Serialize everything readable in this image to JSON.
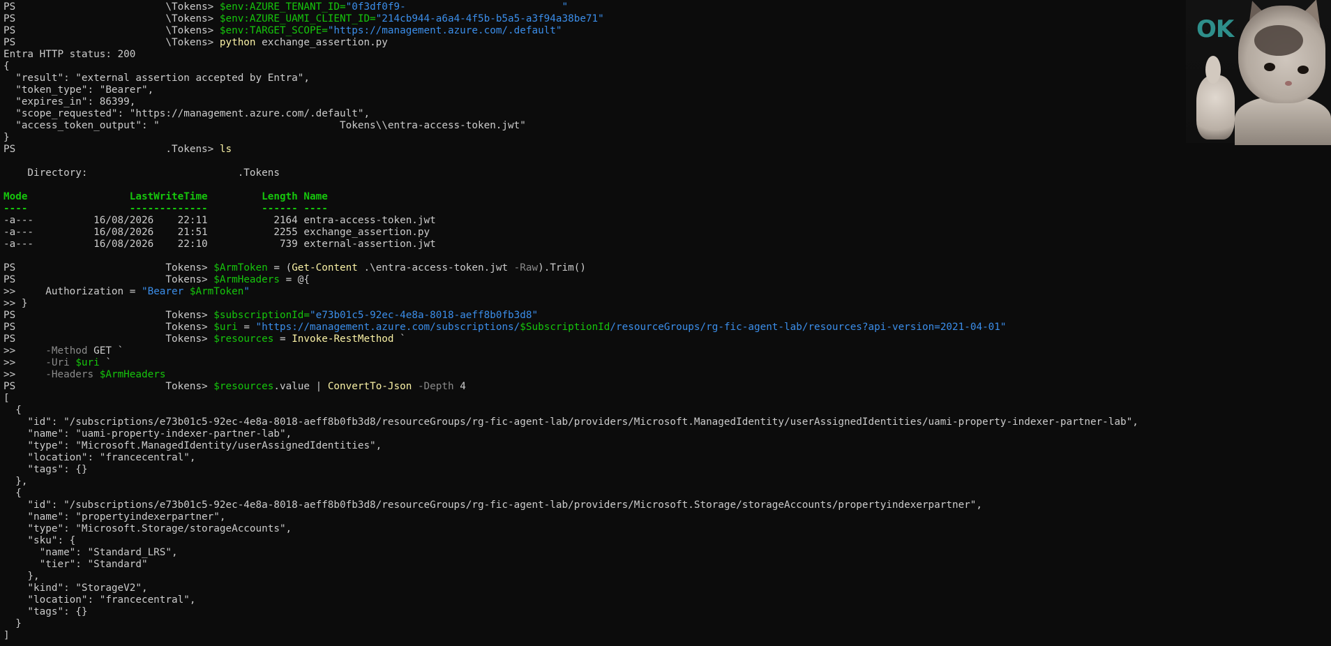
{
  "terminal": {
    "l01": [
      "PS ",
      "                        \\Tokens> ",
      "$env:AZURE_TENANT_ID=",
      "\"0f3df0f9-                          \""
    ],
    "l02": [
      "PS ",
      "                        \\Tokens> ",
      "$env:AZURE_UAMI_CLIENT_ID=",
      "\"214cb944-a6a4-4f5b-b5a5-a3f94a38be71\""
    ],
    "l03": [
      "PS ",
      "                        \\Tokens> ",
      "$env:TARGET_SCOPE=",
      "\"https://management.azure.com/.default\""
    ],
    "l04": [
      "PS ",
      "                        \\Tokens> ",
      "python",
      " exchange_assertion.py"
    ],
    "l05": "Entra HTTP status: 200",
    "l06": "{",
    "l07": "  \"result\": \"external assertion accepted by Entra\",",
    "l08": "  \"token_type\": \"Bearer\",",
    "l09": "  \"expires_in\": 86399,",
    "l10": "  \"scope_requested\": \"https://management.azure.com/.default\",",
    "l11": "  \"access_token_output\": \"                              Tokens\\\\entra-access-token.jwt\"",
    "l12": "}",
    "l13": [
      "PS ",
      "                        .Tokens> ",
      "ls"
    ],
    "l14": "",
    "l15": "    Directory:                         .Tokens",
    "l16": "",
    "l17": [
      "Mode                 LastWriteTime         Length Name"
    ],
    "l18": [
      "----                 -------------         ------ ----"
    ],
    "l19": "-a---          16/08/2026    22:11           2164 entra-access-token.jwt",
    "l20": "-a---          16/08/2026    21:51           2255 exchange_assertion.py",
    "l21": "-a---          16/08/2026    22:10            739 external-assertion.jwt",
    "l22": "",
    "l23": [
      "PS ",
      "                        Tokens> ",
      "$ArmToken",
      " = (",
      "Get-Content",
      " .\\entra-access-token.jwt ",
      "-Raw",
      ").Trim()"
    ],
    "l24": [
      "PS ",
      "                        Tokens> ",
      "$ArmHeaders",
      " = @{"
    ],
    "l25": [
      ">>     Authorization = ",
      "\"Bearer ",
      "$ArmToken",
      "\""
    ],
    "l26": ">> }",
    "l27": [
      "PS ",
      "                        Tokens> ",
      "$subscriptionId=",
      "\"e73b01c5-92ec-4e8a-8018-aeff8b0fb3d8\""
    ],
    "l28": [
      "PS ",
      "                        Tokens> ",
      "$uri",
      " = ",
      "\"https://management.azure.com/subscriptions/",
      "$SubscriptionId",
      "/resourceGroups/rg-fic-agent-lab/resources?api-version=2021-04-01\""
    ],
    "l29": [
      "PS ",
      "                        Tokens> ",
      "$resources",
      " = ",
      "Invoke-RestMethod",
      " `"
    ],
    "l30": [
      ">>     ",
      "-Method",
      " GET `"
    ],
    "l31": [
      ">>     ",
      "-Uri",
      " ",
      "$uri",
      " `"
    ],
    "l32": [
      ">>     ",
      "-Headers",
      " ",
      "$ArmHeaders"
    ],
    "l33": [
      "PS ",
      "                        Tokens> ",
      "$resources",
      ".value | ",
      "ConvertTo-Json",
      " ",
      "-Depth",
      " 4"
    ],
    "l34": "[",
    "l35": "  {",
    "l36": "    \"id\": \"/subscriptions/e73b01c5-92ec-4e8a-8018-aeff8b0fb3d8/resourceGroups/rg-fic-agent-lab/providers/Microsoft.ManagedIdentity/userAssignedIdentities/uami-property-indexer-partner-lab\",",
    "l37": "    \"name\": \"uami-property-indexer-partner-lab\",",
    "l38": "    \"type\": \"Microsoft.ManagedIdentity/userAssignedIdentities\",",
    "l39": "    \"location\": \"francecentral\",",
    "l40": "    \"tags\": {}",
    "l41": "  },",
    "l42": "  {",
    "l43": "    \"id\": \"/subscriptions/e73b01c5-92ec-4e8a-8018-aeff8b0fb3d8/resourceGroups/rg-fic-agent-lab/providers/Microsoft.Storage/storageAccounts/propertyindexerpartner\",",
    "l44": "    \"name\": \"propertyindexerpartner\",",
    "l45": "    \"type\": \"Microsoft.Storage/storageAccounts\",",
    "l46": "    \"sku\": {",
    "l47": "      \"name\": \"Standard_LRS\",",
    "l48": "      \"tier\": \"Standard\"",
    "l49": "    },",
    "l50": "    \"kind\": \"StorageV2\",",
    "l51": "    \"location\": \"francecentral\",",
    "l52": "    \"tags\": {}",
    "l53": "  }",
    "l54": "]"
  },
  "sticker": {
    "text": "OK",
    "icon": "thumbs-up-cat-icon"
  },
  "colors": {
    "background": "#0c0c0c",
    "foreground": "#cccccc",
    "variable": "#16c60c",
    "string": "#3b8eea",
    "command": "#f9f1a5",
    "parameter": "#8a8a8a",
    "sticker_text": "#2e8f8b"
  }
}
